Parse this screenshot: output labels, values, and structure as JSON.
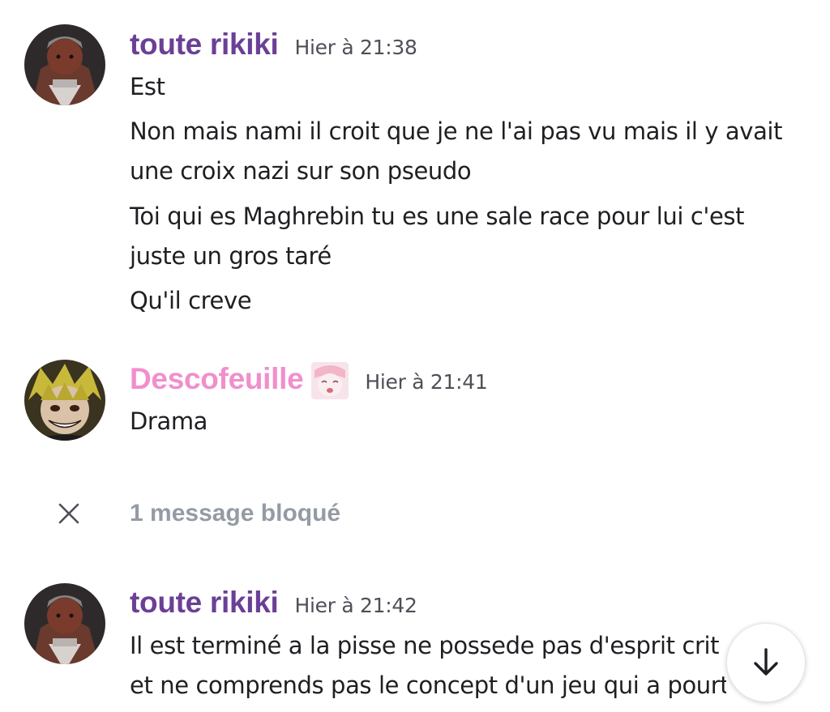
{
  "colors": {
    "user1_name": "#6b3f96",
    "user2_name": "#f08fcd",
    "timestamp": "#4e5058",
    "message_text": "#1f1f23",
    "blocked": "#949ba4"
  },
  "messages": [
    {
      "author": "toute rikiki",
      "timestamp": "Hier à 21:38",
      "lines": [
        "Est",
        "Non mais nami il croit que je ne l'ai pas vu mais il y avait une croix nazi sur son pseudo",
        "Toi qui es Maghrebin tu es une sale race pour lui c'est juste un gros taré",
        "Qu'il creve"
      ]
    },
    {
      "author": "Descofeuille",
      "timestamp": "Hier à 21:41",
      "lines": [
        "Drama"
      ]
    },
    {
      "author": "toute rikiki",
      "timestamp": "Hier à 21:42",
      "lines": [
        "Il est terminé a la pisse ne possede pas d'esprit crit",
        "et ne comprends pas le concept d'un jeu qui a pourt"
      ]
    }
  ],
  "blocked": {
    "label": "1 message bloqué"
  },
  "icons": {
    "close": "close-icon",
    "scroll_down": "arrow-down-icon"
  }
}
